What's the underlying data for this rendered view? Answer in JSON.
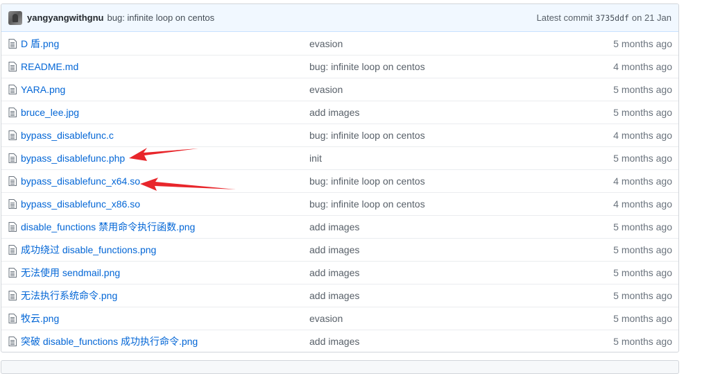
{
  "commit": {
    "author": "yangyangwithgnu",
    "message": "bug: infinite loop on centos",
    "latest_prefix": "Latest commit",
    "sha": "3735ddf",
    "date": "on 21 Jan"
  },
  "files": [
    {
      "name": "D 盾.png",
      "message": "evasion",
      "age": "5 months ago"
    },
    {
      "name": "README.md",
      "message": "bug: infinite loop on centos",
      "age": "4 months ago"
    },
    {
      "name": "YARA.png",
      "message": "evasion",
      "age": "5 months ago"
    },
    {
      "name": "bruce_lee.jpg",
      "message": "add images",
      "age": "5 months ago"
    },
    {
      "name": "bypass_disablefunc.c",
      "message": "bug: infinite loop on centos",
      "age": "4 months ago"
    },
    {
      "name": "bypass_disablefunc.php",
      "message": "init",
      "age": "5 months ago"
    },
    {
      "name": "bypass_disablefunc_x64.so",
      "message": "bug: infinite loop on centos",
      "age": "4 months ago"
    },
    {
      "name": "bypass_disablefunc_x86.so",
      "message": "bug: infinite loop on centos",
      "age": "4 months ago"
    },
    {
      "name": "disable_functions 禁用命令执行函数.png",
      "message": "add images",
      "age": "5 months ago"
    },
    {
      "name": "成功绕过 disable_functions.png",
      "message": "add images",
      "age": "5 months ago"
    },
    {
      "name": "无法使用 sendmail.png",
      "message": "add images",
      "age": "5 months ago"
    },
    {
      "name": "无法执行系统命令.png",
      "message": "add images",
      "age": "5 months ago"
    },
    {
      "name": "牧云.png",
      "message": "evasion",
      "age": "5 months ago"
    },
    {
      "name": "突破 disable_functions 成功执行命令.png",
      "message": "add images",
      "age": "5 months ago"
    }
  ],
  "icons": {
    "file": "file-icon",
    "avatar": "avatar",
    "arrow": "arrow-annotation"
  },
  "colors": {
    "link": "#0366d6",
    "muted": "#586069",
    "annotation": "#e8262b",
    "commit_bg": "#f1f8ff"
  }
}
